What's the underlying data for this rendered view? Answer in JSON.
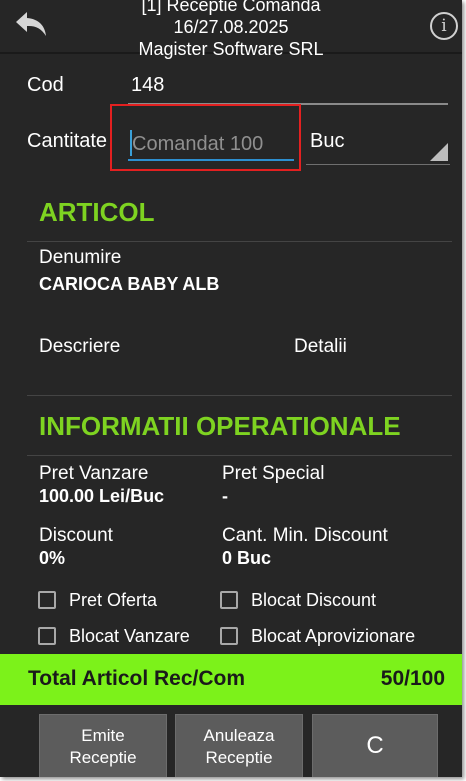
{
  "header": {
    "title_line1": "[1] Receptie Comanda",
    "title_line2": "16/27.08.2025",
    "title_line3": "Magister Software SRL",
    "info_glyph": "i"
  },
  "form": {
    "cod_label": "Cod",
    "cod_value": "148",
    "cantitate_label": "Cantitate",
    "cantitate_value": "",
    "cantitate_placeholder": "Comandat 100",
    "unit_value": "Buc"
  },
  "articol": {
    "section_title": "ARTICOL",
    "denumire_label": "Denumire",
    "denumire_value": "CARIOCA BABY ALB",
    "descriere_label": "Descriere",
    "detalii_label": "Detalii"
  },
  "info": {
    "section_title": "INFORMATII OPERATIONALE",
    "pret_vanzare_label": "Pret Vanzare",
    "pret_vanzare_value": "100.00 Lei/Buc",
    "pret_special_label": "Pret Special",
    "pret_special_value": "-",
    "discount_label": "Discount",
    "discount_value": "0%",
    "cant_min_label": "Cant. Min. Discount",
    "cant_min_value": "0 Buc"
  },
  "checkboxes": {
    "pret_oferta": "Pret Oferta",
    "blocat_discount": "Blocat Discount",
    "blocat_vanzare": "Blocat Vanzare",
    "blocat_aprovizionare": "Blocat Aprovizionare"
  },
  "total": {
    "label": "Total Articol Rec/Com",
    "value": "50/100"
  },
  "buttons": {
    "emite_line1": "Emite",
    "emite_line2": "Receptie",
    "anuleaza_line1": "Anuleaza",
    "anuleaza_line2": "Receptie",
    "c_label": "C"
  },
  "colors": {
    "accent_green": "#7ed321",
    "total_bar": "#7cf21a",
    "background": "#262626",
    "highlight": "#e32020"
  },
  "icons": {
    "back": "back-arrow-icon",
    "info": "info-icon",
    "dropdown": "dropdown-triangle-icon",
    "checkbox": "checkbox-icon"
  }
}
